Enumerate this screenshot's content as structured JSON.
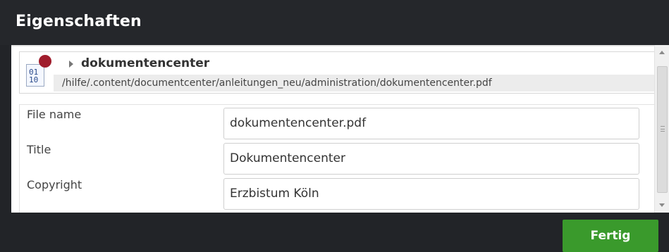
{
  "dialog": {
    "title": "Eigenschaften",
    "done_label": "Fertig"
  },
  "resource": {
    "name": "dokumentencenter",
    "path": "/hilfe/.content/documentcenter/anleitungen_neu/administration/dokumentencenter.pdf",
    "icon": "binary-file-icon",
    "icon_text_line1": "01",
    "icon_text_line2": "10",
    "status_color": "#a01c2c"
  },
  "properties": [
    {
      "label": "File name",
      "value": "dokumentencenter.pdf"
    },
    {
      "label": "Title",
      "value": "Dokumentencenter"
    },
    {
      "label": "Copyright",
      "value": "Erzbistum Köln"
    }
  ],
  "colors": {
    "header_bg": "#25272b",
    "done_button": "#3a9a2c"
  }
}
